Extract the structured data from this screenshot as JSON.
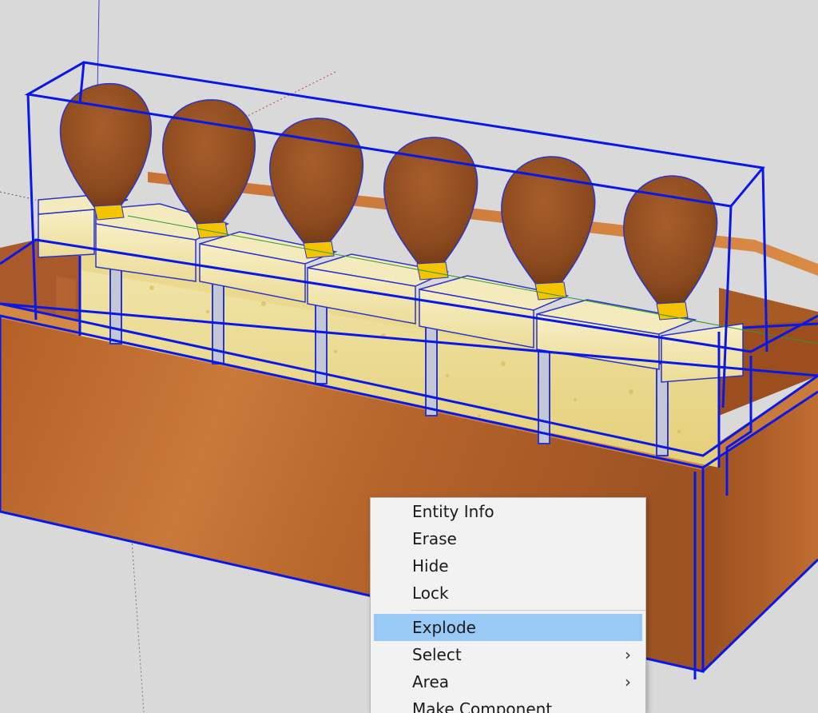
{
  "context_menu": {
    "items": [
      {
        "label": "Entity Info"
      },
      {
        "label": "Erase"
      },
      {
        "label": "Hide"
      },
      {
        "label": "Lock"
      },
      {
        "label": "Explode",
        "highlighted": true
      },
      {
        "label": "Select",
        "submenu": true
      },
      {
        "label": "Area",
        "submenu": true
      },
      {
        "label": "Make Component"
      }
    ]
  },
  "colors": {
    "background": "#d9d9d9",
    "selection_blue": "#0a18e6",
    "wood": "#b8642a",
    "foam": "#e9d98a",
    "handle": "#8c4a1f",
    "ferrule": "#f5c400",
    "menu_highlight": "#99c9f5"
  },
  "icons": {
    "submenu": "chevron-right-icon"
  }
}
